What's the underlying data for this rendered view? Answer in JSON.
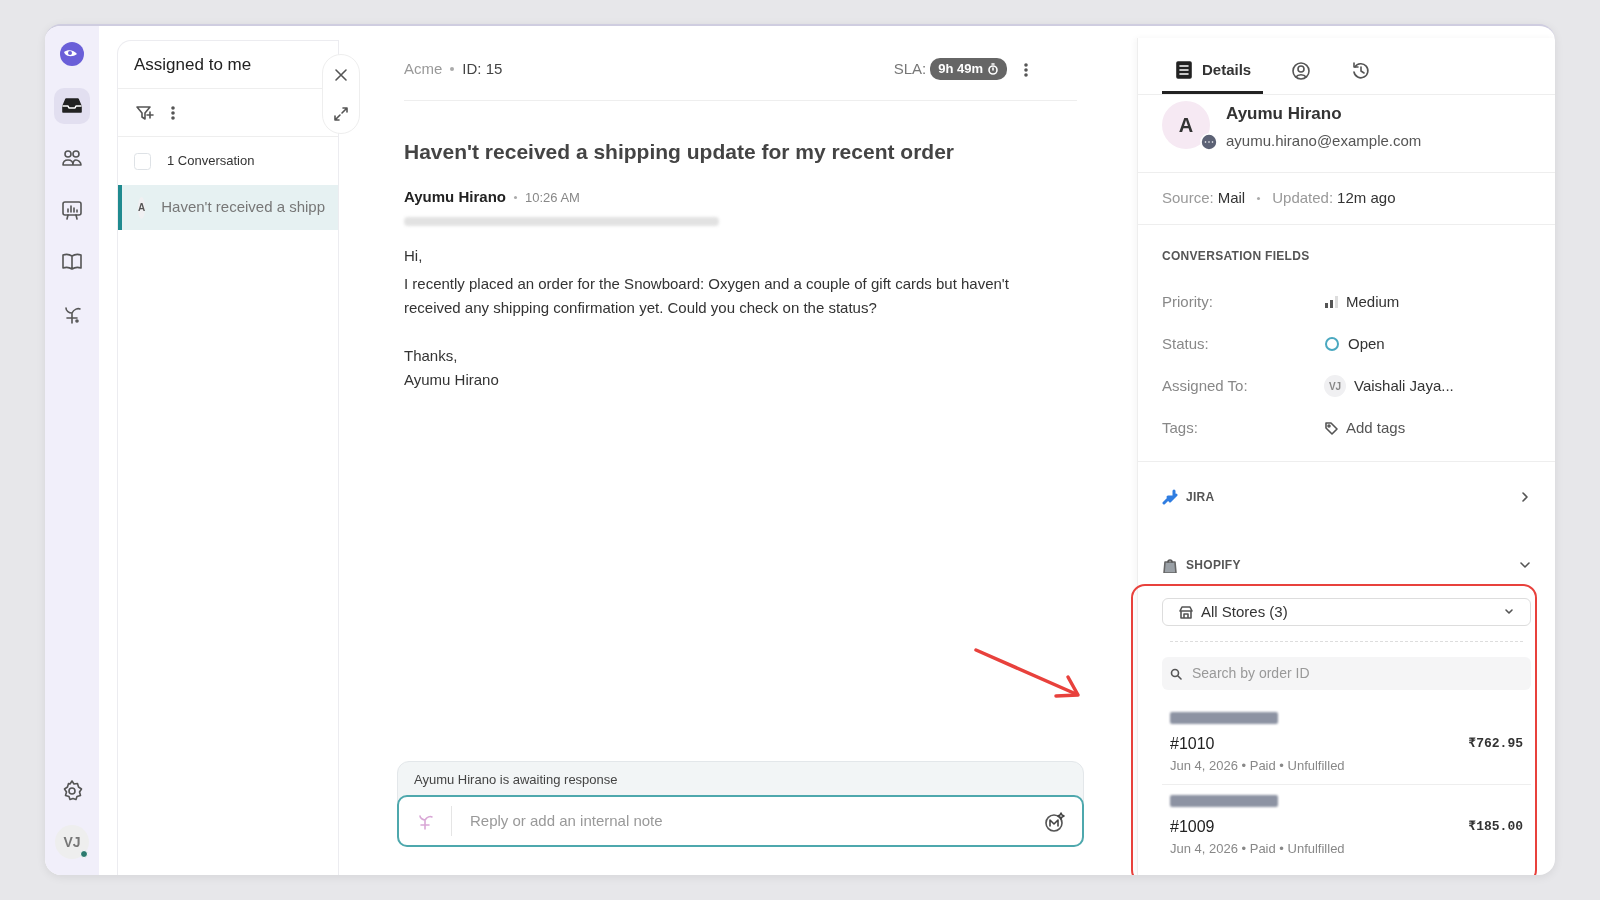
{
  "rail": {
    "items": [
      {
        "kind": "inbox",
        "selected": true
      },
      {
        "kind": "contacts",
        "selected": false
      },
      {
        "kind": "reports",
        "selected": false
      },
      {
        "kind": "knowledge",
        "selected": false
      },
      {
        "kind": "automation",
        "selected": false
      }
    ],
    "user": {
      "initials": "VJ",
      "online": true
    }
  },
  "list": {
    "title": "Assigned to me",
    "count": "1 Conversation",
    "select_all": false,
    "conversations": [
      {
        "avatar": "A",
        "subject": "Haven't received a shipp",
        "selected": true
      }
    ]
  },
  "conversation": {
    "org": "Acme",
    "id": "ID: 15",
    "sla_label": "SLA:",
    "sla": "9h 49m",
    "subject": "Haven't received a shipping update for my recent order",
    "message": {
      "author": "Ayumu Hirano",
      "time": "10:26 AM",
      "greeting": "Hi,",
      "body": "I recently placed an order for the Snowboard: Oxygen and a couple of gift cards but haven't received any shipping confirmation yet. Could you check on the status?",
      "closing": "Thanks,",
      "signature": "Ayumu Hirano"
    },
    "awaiting": "Ayumu Hirano is awaiting response",
    "reply": {
      "placeholder": "Reply or add an internal note"
    }
  },
  "details": {
    "tabs": [
      {
        "kind": "details",
        "label": "Details",
        "selected": true
      },
      {
        "kind": "contact",
        "selected": false
      },
      {
        "kind": "history",
        "selected": false
      }
    ],
    "contact": {
      "initial": "A",
      "name": "Ayumu Hirano",
      "email": "ayumu.hirano@example.com"
    },
    "meta": {
      "source_label": "Source:",
      "source": "Mail",
      "updated_label": "Updated:",
      "updated": "12m ago"
    },
    "fields_title": "CONVERSATION FIELDS",
    "fields": [
      {
        "kind": "priority",
        "label": "Priority:",
        "value": "Medium"
      },
      {
        "kind": "status",
        "label": "Status:",
        "value": "Open"
      },
      {
        "kind": "assignee",
        "label": "Assigned To:",
        "initials": "VJ",
        "value": "Vaishali Jaya..."
      },
      {
        "kind": "tags",
        "label": "Tags:",
        "value": "Add tags"
      }
    ],
    "integrations": [
      {
        "kind": "jira",
        "name": "JIRA",
        "expanded": false
      },
      {
        "kind": "shopify",
        "name": "SHOPIFY",
        "expanded": true
      }
    ],
    "shopify": {
      "store": "All Stores (3)",
      "search": {
        "placeholder": "Search by order ID"
      },
      "orders": [
        {
          "number": "#1010",
          "amount": "₹762.95",
          "details": "Jun 4, 2026 • Paid • Unfulfilled"
        },
        {
          "number": "#1009",
          "amount": "₹185.00",
          "details": "Jun 4, 2026 • Paid • Unfulfilled"
        }
      ]
    }
  }
}
